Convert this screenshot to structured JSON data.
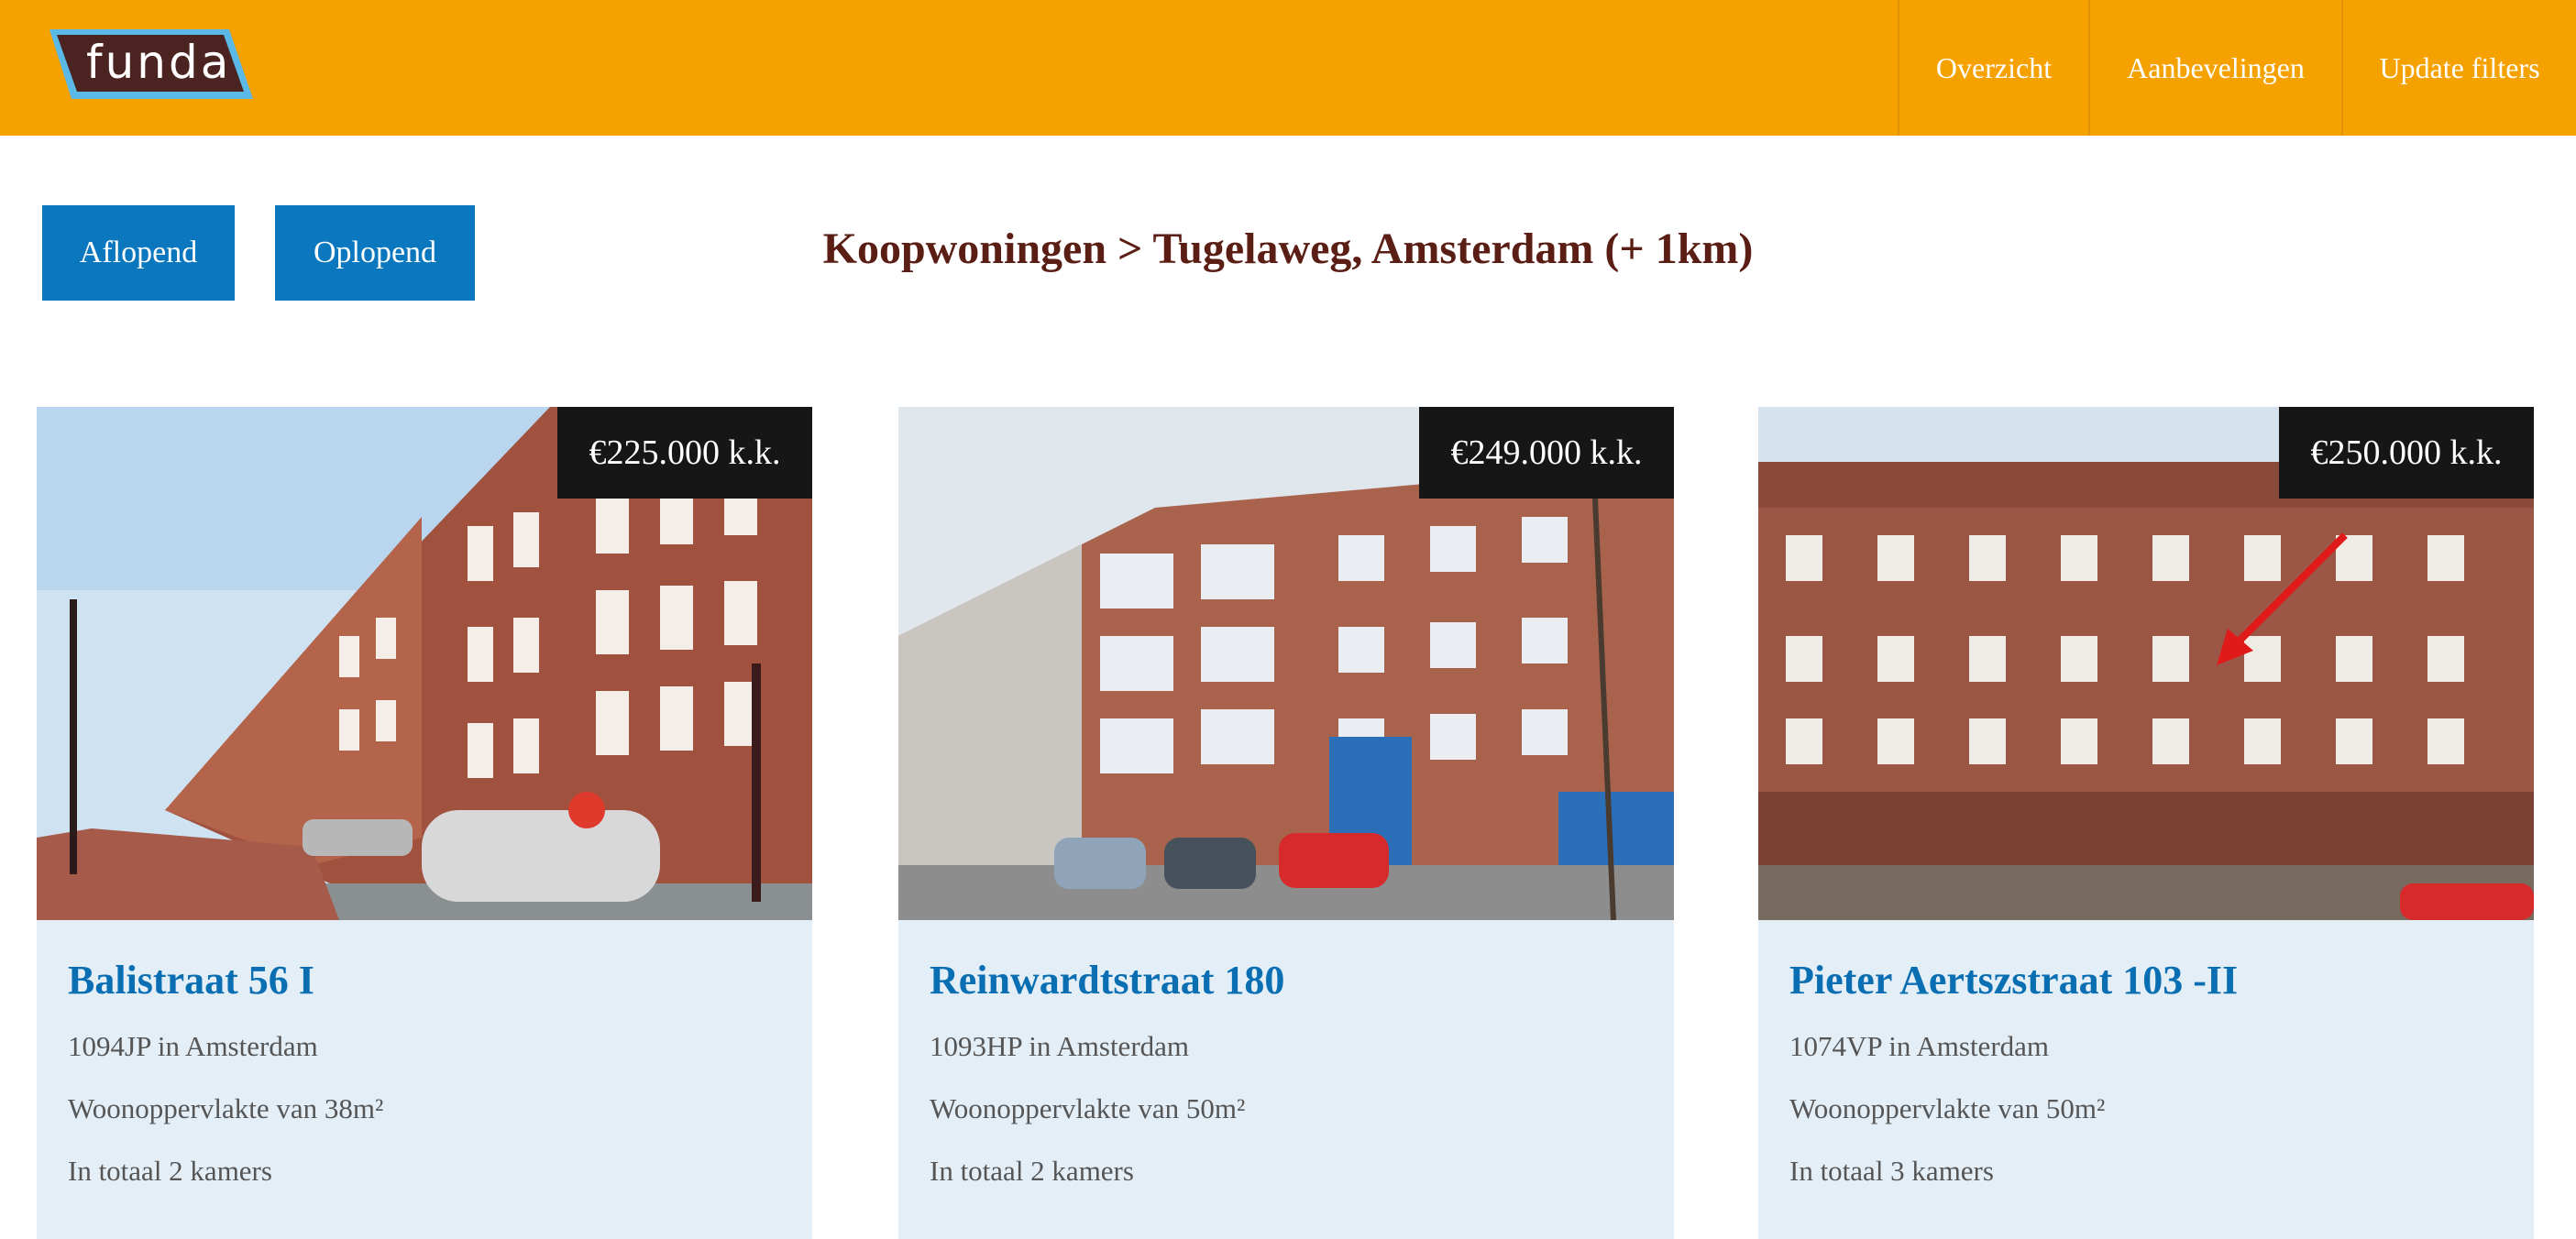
{
  "header": {
    "logo_text": "funda",
    "nav": [
      {
        "label": "Overzicht"
      },
      {
        "label": "Aanbevelingen"
      },
      {
        "label": "Update filters"
      }
    ]
  },
  "controls": {
    "sort_desc_label": "Aflopend",
    "sort_asc_label": "Oplopend"
  },
  "page_title": "Koopwoningen > Tugelaweg, Amsterdam (+ 1km)",
  "listings": [
    {
      "price": "€225.000 k.k.",
      "title": "Balistraat 56 I",
      "postcode_city": "1094JP in Amsterdam",
      "living_area": "Woonoppervlakte van 38m²",
      "rooms": "In totaal 2 kamers"
    },
    {
      "price": "€249.000 k.k.",
      "title": "Reinwardtstraat 180",
      "postcode_city": "1093HP in Amsterdam",
      "living_area": "Woonoppervlakte van 50m²",
      "rooms": "In totaal 2 kamers"
    },
    {
      "price": "€250.000 k.k.",
      "title": "Pieter Aertszstraat 103 -II",
      "postcode_city": "1074VP in Amsterdam",
      "living_area": "Woonoppervlakte van 50m²",
      "rooms": "In totaal 3 kamers"
    }
  ],
  "colors": {
    "header_bg": "#f5a200",
    "button_bg": "#0a77be",
    "title_color": "#5a1e14",
    "card_title_color": "#0a6fb2",
    "card_info_bg": "#e3eef7",
    "price_bg": "#161616"
  }
}
